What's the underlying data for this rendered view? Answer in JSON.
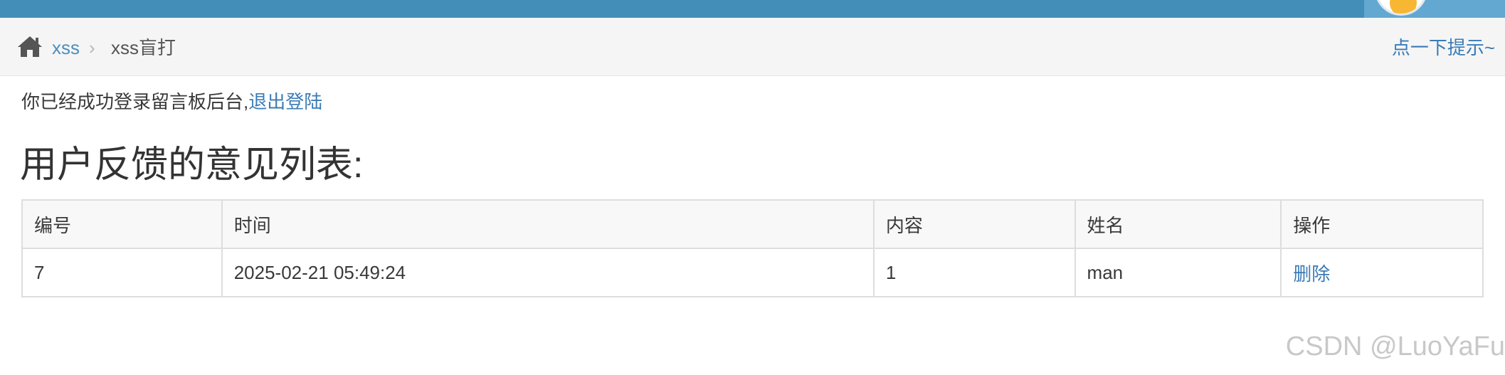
{
  "header": {
    "brand_cropped": "",
    "user_name_cropped": "",
    "colors": {
      "navbar": "#438eb9",
      "user_box": "#62a8d1"
    }
  },
  "breadcrumb": {
    "home_icon": "home-icon",
    "link_label": "xss",
    "separator_icon": "chevron-right-icon",
    "current_label": "xss盲打",
    "hint_label": "点一下提示~"
  },
  "status": {
    "message": "你已经成功登录留言板后台,",
    "logout_label": "退出登陆"
  },
  "list": {
    "title": "用户反馈的意见列表:",
    "headers": [
      "编号",
      "时间",
      "内容",
      "姓名",
      "操作"
    ],
    "rows": [
      {
        "id": "7",
        "time": "2025-02-21 05:49:24",
        "content": "1",
        "name": "man",
        "action": "删除"
      }
    ]
  },
  "watermark": "CSDN @LuoYaFu",
  "colors": {
    "link": "#3a7bb6",
    "breadcrumb_bg": "#f5f5f5",
    "table_border": "#dddddd"
  }
}
